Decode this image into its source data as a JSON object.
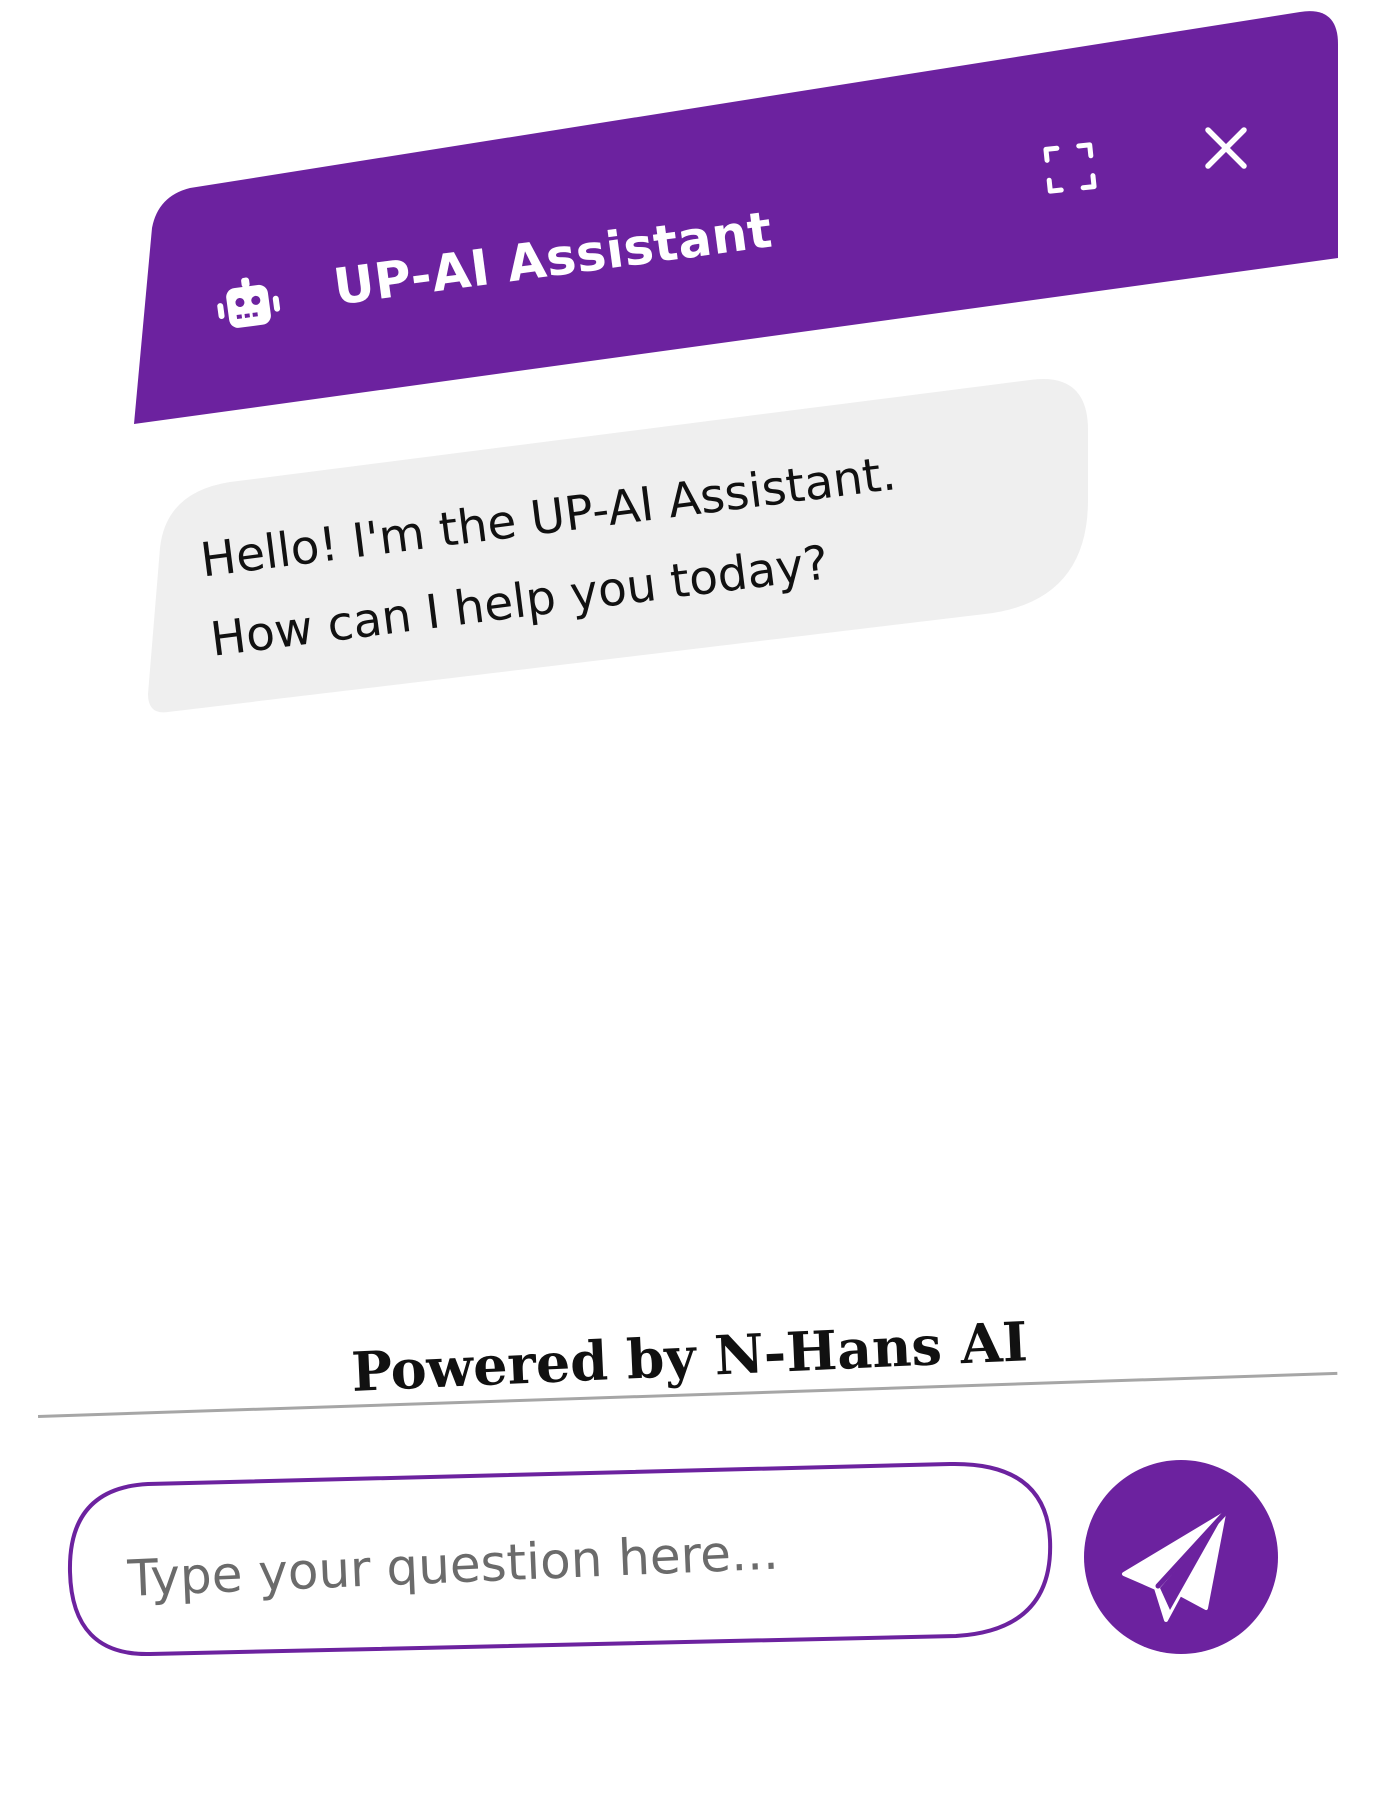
{
  "header": {
    "title": "UP-AI Assistant",
    "bot_icon": "robot-icon",
    "expand_icon": "expand-icon",
    "close_icon": "close-icon",
    "background": "#6c229f"
  },
  "messages": [
    {
      "sender": "assistant",
      "lines": [
        "Hello! I'm the UP-AI Assistant.",
        "How can I help you today?"
      ],
      "bubble_color": "#efefef"
    }
  ],
  "footer": {
    "powered_by": "Powered by N-Hans AI"
  },
  "composer": {
    "placeholder": "Type your question here...",
    "value": "",
    "send_icon": "paper-plane-icon",
    "accent": "#6c229f"
  }
}
